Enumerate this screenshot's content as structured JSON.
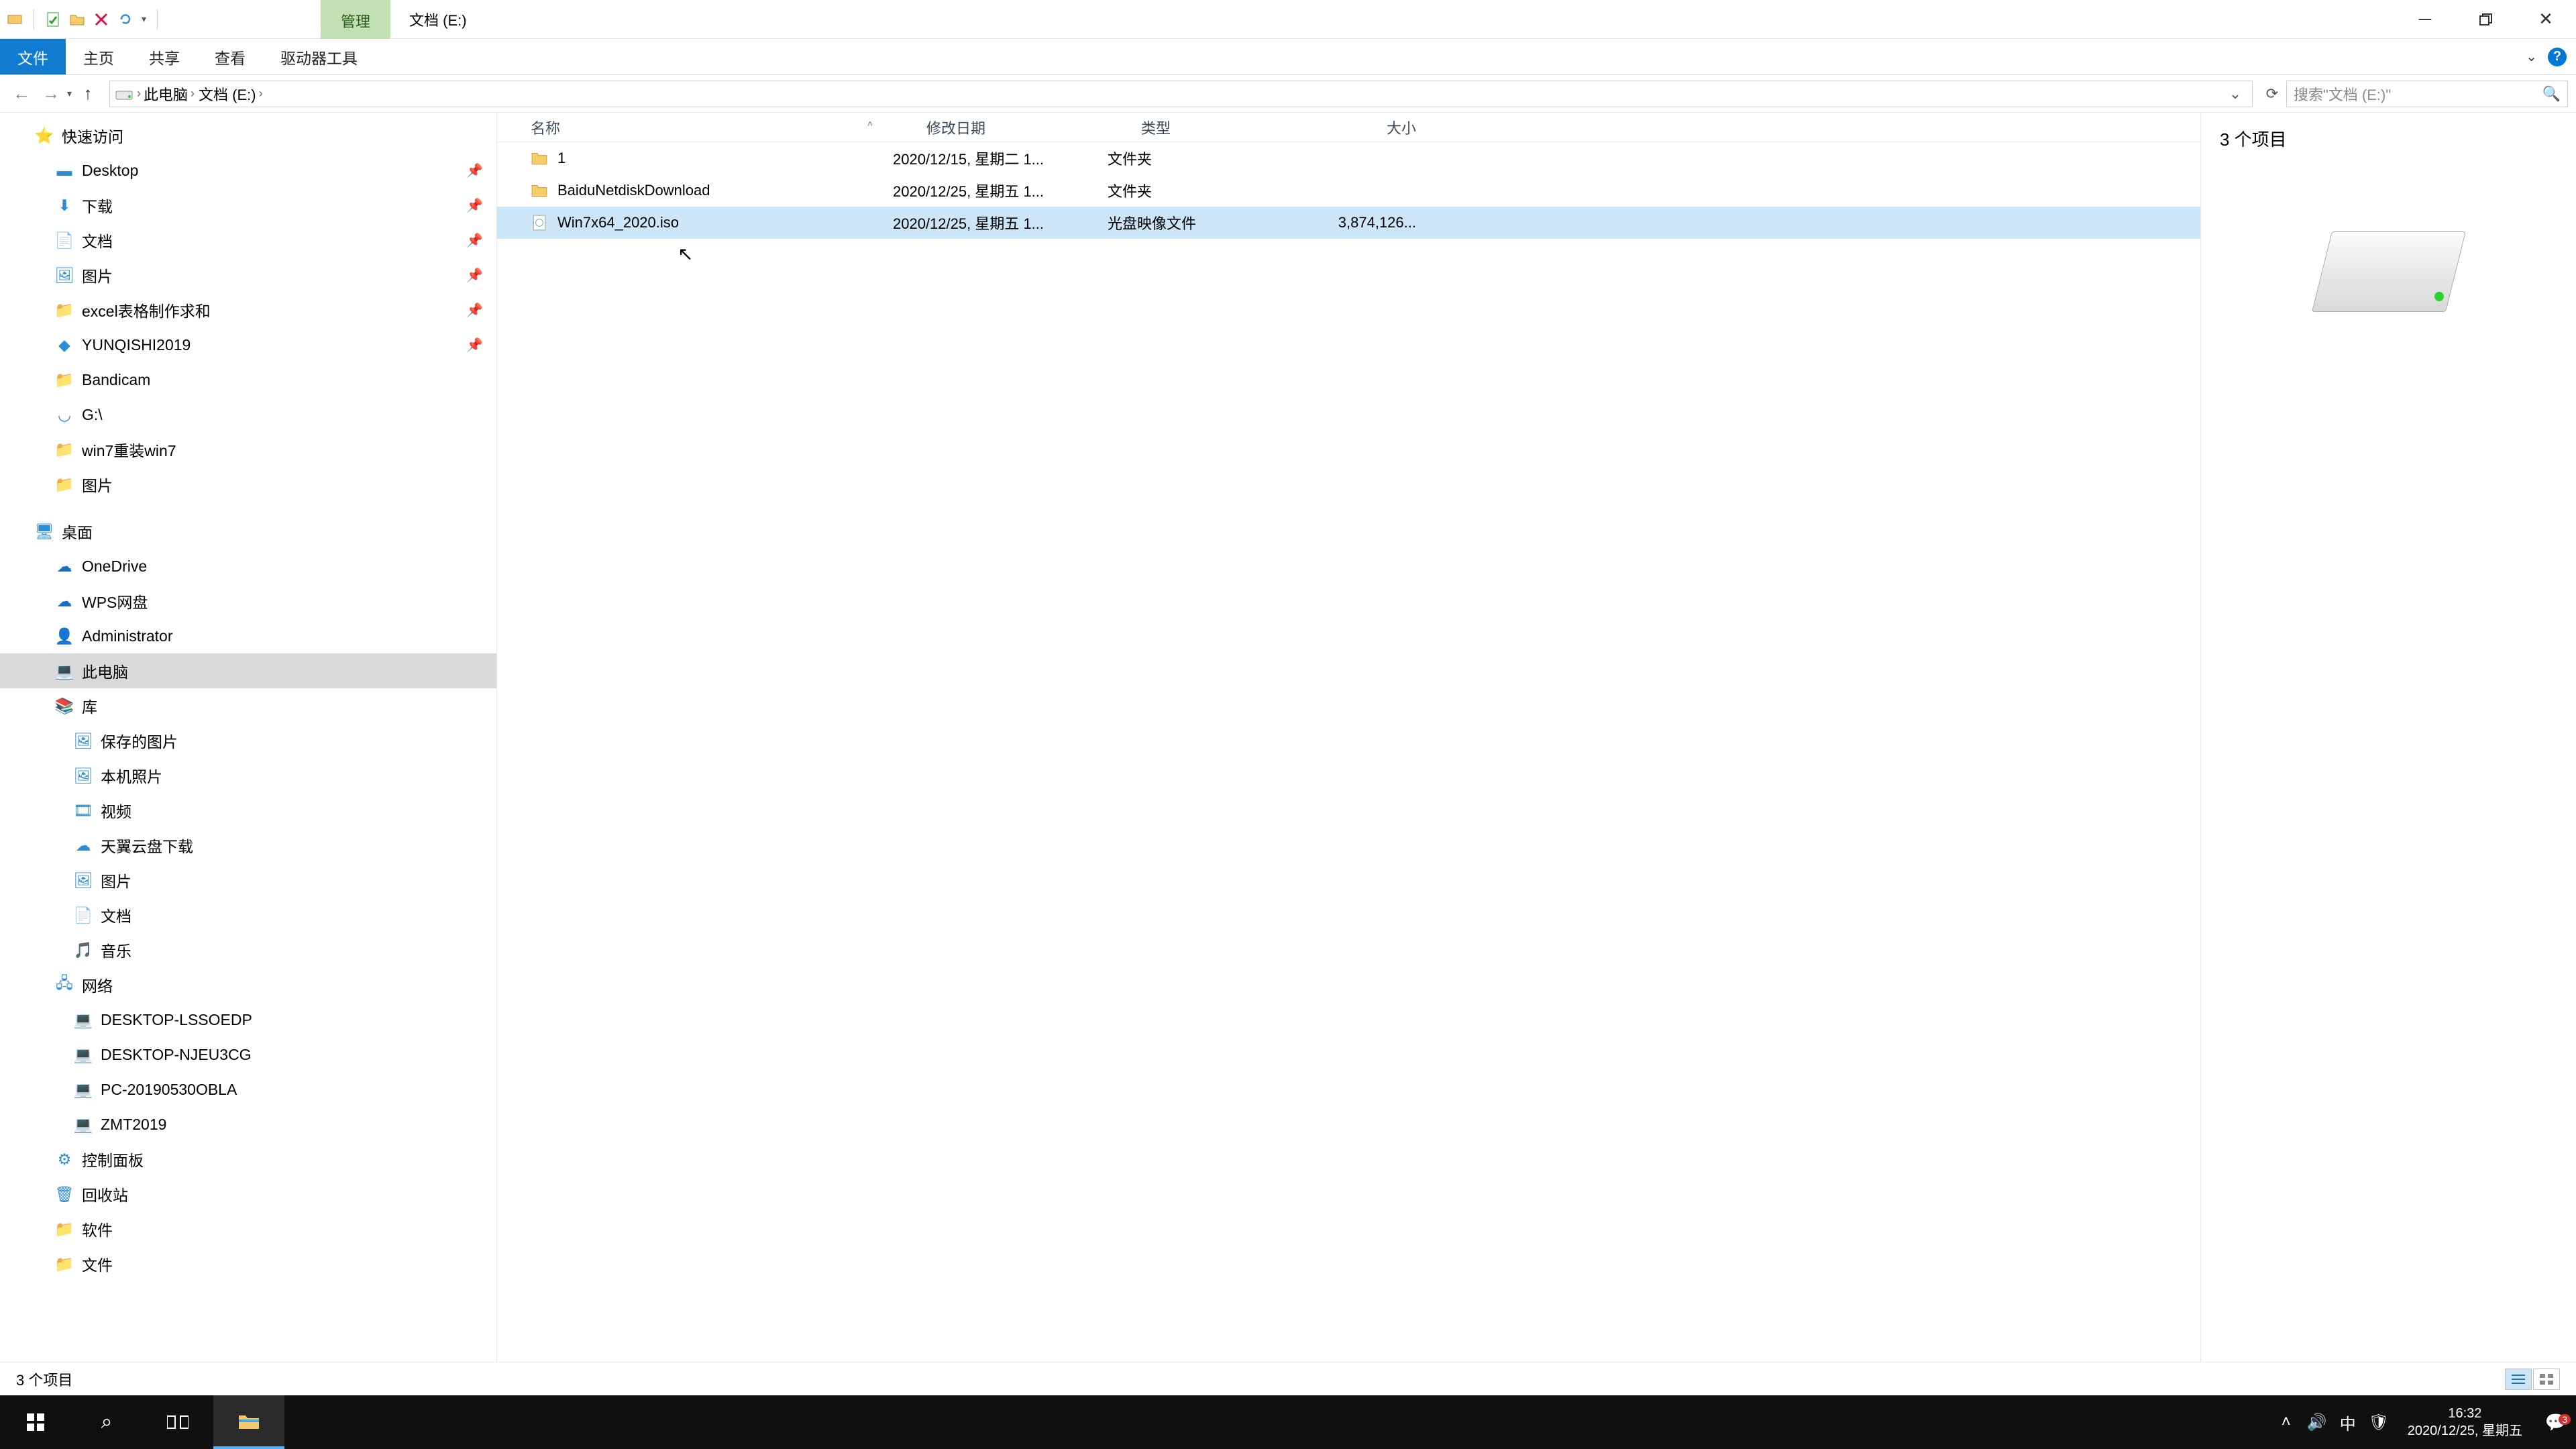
{
  "window": {
    "ctx_tab": "管理",
    "title": "文档 (E:)"
  },
  "ribbon": {
    "file": "文件",
    "home": "主页",
    "share": "共享",
    "view": "查看",
    "drive_tools": "驱动器工具"
  },
  "address": {
    "root": "此电脑",
    "loc": "文档 (E:)",
    "search_placeholder": "搜索\"文档 (E:)\""
  },
  "sidebar": {
    "quick_access": "快速访问",
    "desktop": "Desktop",
    "downloads": "下载",
    "documents": "文档",
    "pictures": "图片",
    "excel_req": "excel表格制作求和",
    "yunqishi": "YUNQISHI2019",
    "bandicam": "Bandicam",
    "g_drive": "G:\\",
    "win7reinstall": "win7重装win7",
    "pictures2": "图片",
    "desktop_cn": "桌面",
    "onedrive": "OneDrive",
    "wps": "WPS网盘",
    "admin": "Administrator",
    "this_pc": "此电脑",
    "library": "库",
    "saved_pics": "保存的图片",
    "cam_roll": "本机照片",
    "videos": "视频",
    "tianyi": "天翼云盘下载",
    "pics_lib": "图片",
    "docs_lib": "文档",
    "music": "音乐",
    "network": "网络",
    "pc1": "DESKTOP-LSSOEDP",
    "pc2": "DESKTOP-NJEU3CG",
    "pc3": "PC-20190530OBLA",
    "pc4": "ZMT2019",
    "ctrl_panel": "控制面板",
    "recycle": "回收站",
    "software": "软件",
    "file_folder": "文件"
  },
  "columns": {
    "name": "名称",
    "date": "修改日期",
    "type": "类型",
    "size": "大小"
  },
  "files": [
    {
      "name": "1",
      "date": "2020/12/15, 星期二 1...",
      "type": "文件夹",
      "size": "",
      "kind": "folder",
      "selected": false
    },
    {
      "name": "BaiduNetdiskDownload",
      "date": "2020/12/25, 星期五 1...",
      "type": "文件夹",
      "size": "",
      "kind": "folder",
      "selected": false
    },
    {
      "name": "Win7x64_2020.iso",
      "date": "2020/12/25, 星期五 1...",
      "type": "光盘映像文件",
      "size": "3,874,126...",
      "kind": "iso",
      "selected": true
    }
  ],
  "preview": {
    "count_text": "3 个项目"
  },
  "status": {
    "text": "3 个项目"
  },
  "tray": {
    "ime": "中",
    "time": "16:32",
    "date": "2020/12/25, 星期五",
    "notif_count": "3"
  }
}
